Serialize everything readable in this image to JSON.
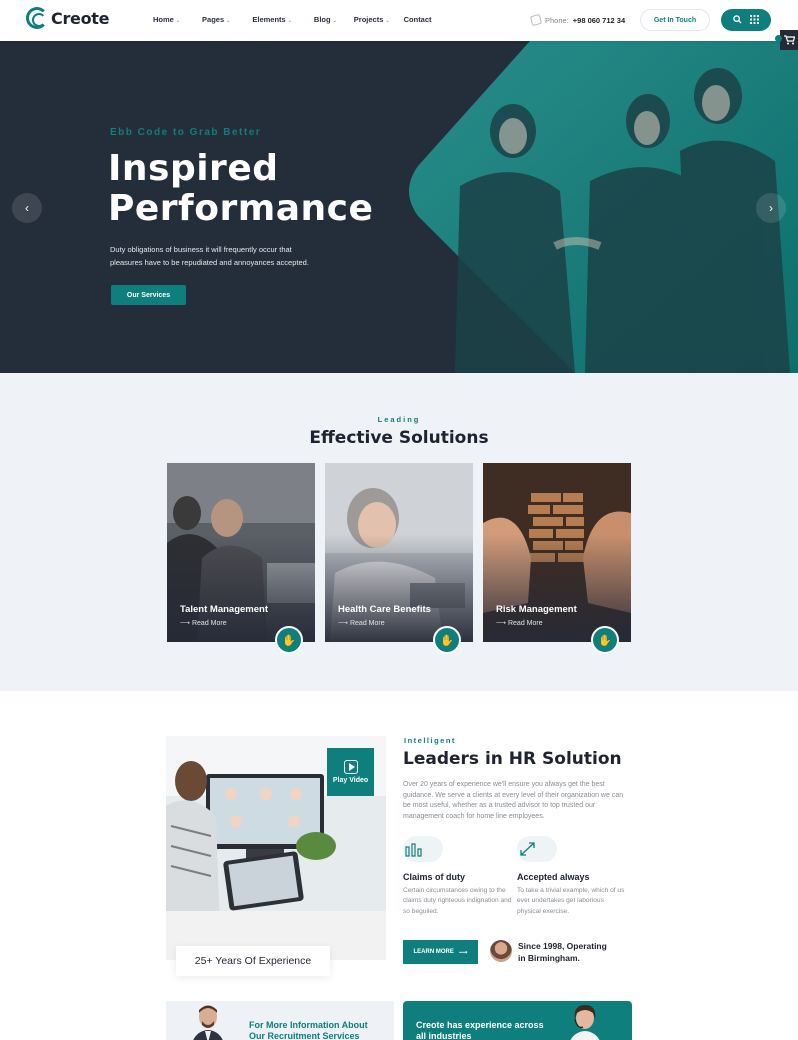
{
  "header": {
    "logo_text": "Creote",
    "nav": [
      {
        "label": "Home",
        "has_dropdown": true
      },
      {
        "label": "Pages",
        "has_dropdown": true
      },
      {
        "label": "Elements",
        "has_dropdown": true
      },
      {
        "label": "Blog",
        "has_dropdown": true
      },
      {
        "label": "Projects",
        "has_dropdown": true
      },
      {
        "label": "Contact",
        "has_dropdown": false
      }
    ],
    "phone_label": "Phone:",
    "phone_number": "+98 060 712 34",
    "cta_label": "Get In Touch",
    "icons": [
      "search-icon",
      "grid-icon",
      "cart-icon"
    ]
  },
  "hero": {
    "eyebrow": "Ebb Code to Grab Better",
    "title_line1": "Inspired",
    "title_line2": "Performance",
    "text_line1": "Duty obligations of business it will frequently occur that",
    "text_line2": "pleasures have to be repudiated and annoyances accepted.",
    "button_label": "Our Services",
    "prev_arrow": "‹",
    "next_arrow": "›"
  },
  "solutions": {
    "eyebrow": "Leading",
    "title": "Effective Solutions",
    "cards": [
      {
        "title": "Talent Management",
        "link": "Read More"
      },
      {
        "title": "Health Care Benefits",
        "link": "Read More"
      },
      {
        "title": "Risk Management",
        "link": "Read More"
      }
    ]
  },
  "hr": {
    "eyebrow": "Intelligent",
    "title": "Leaders in HR Solution",
    "text": "Over 20 years of experience we'll ensure you always get the best guidance. We serve a clients at every level of their organization we can be most useful, whether as a trusted advisor to top trusted our management coach for home line employees.",
    "play_label": "Play Video",
    "years_label": "25+ Years Of Experience",
    "features": [
      {
        "title": "Claims of duty",
        "text": "Certain circumstances owing to the claims duty righteous indignation and so beguiled."
      },
      {
        "title": "Accepted always",
        "text": "To take a trivial example, which of us ever undertakes get laborious physical exercise."
      }
    ],
    "learn_label": "LEARN MORE",
    "since_line1": "Since 1998, Operating",
    "since_line2": "in Birmingham."
  },
  "info": {
    "left_line1": "For More Information About",
    "left_line2": "Our Recruitment Services",
    "right_line1": "Creote has experience across",
    "right_line2": "all industries"
  },
  "colors": {
    "accent": "#0e7f7c",
    "dark": "#262a37",
    "section_bg": "#eff2f7"
  }
}
